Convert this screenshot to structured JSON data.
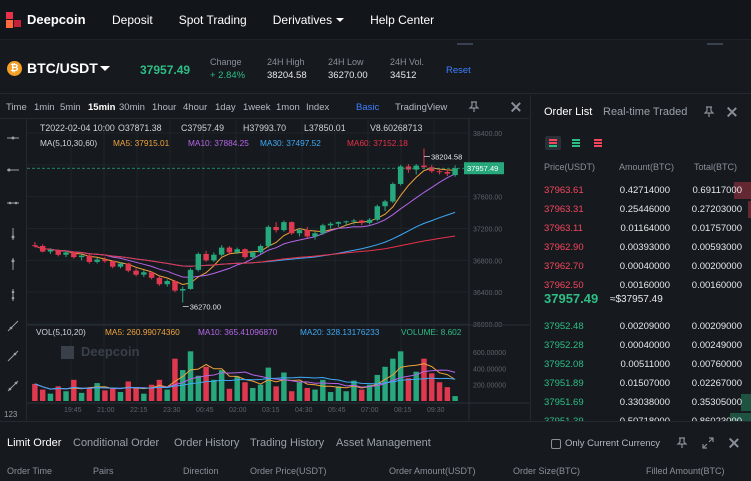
{
  "nav": {
    "brand": "Deepcoin",
    "items": [
      "Deposit",
      "Spot Trading",
      "Derivatives",
      "Help Center"
    ]
  },
  "ticker": {
    "coin_symbol": "₿",
    "pair": "BTC/USDT",
    "last_price": "37957.49",
    "stats": [
      {
        "label": "Change",
        "value": "+ 2.84%"
      },
      {
        "label": "24H High",
        "value": "38204.58"
      },
      {
        "label": "24H Low",
        "value": "36270.00"
      },
      {
        "label": "24H Vol.",
        "value": "34512"
      }
    ],
    "reset": "Reset"
  },
  "chart_toolbar": {
    "timeframes": [
      "Time",
      "1min",
      "5min",
      "15min",
      "30min",
      "1hour",
      "4hour",
      "1day",
      "1week",
      "1mon",
      "Index"
    ],
    "active": "15min",
    "views": [
      "Basic",
      "TradingView"
    ]
  },
  "chart_data": {
    "type": "candlestick",
    "info_line": [
      "T2022-02-04 10:00",
      "O37871.38",
      "C37957.49",
      "H37993.70",
      "L37850.01",
      "V8.60268713"
    ],
    "ma_label": "MA(5,10,30,60)",
    "ma_values": [
      {
        "name": "MA5",
        "text": "MA5: 37915.01",
        "color": "#f0a23b"
      },
      {
        "name": "MA10",
        "text": "MA10: 37884.25",
        "color": "#b565e8"
      },
      {
        "name": "MA30",
        "text": "MA30: 37497.52",
        "color": "#3fa9f5"
      },
      {
        "name": "MA60",
        "text": "MA60: 37152.18",
        "color": "#e8314a"
      }
    ],
    "price_axis": [
      "38400.00",
      "38000.00",
      "37600.00",
      "37200.00",
      "36800.00",
      "36400.00",
      "36000.00"
    ],
    "ylim": [
      36000,
      38400
    ],
    "high_marker": "38204.58",
    "low_marker": "36270.00",
    "last_label": "37957.49",
    "candles": [
      [
        36990,
        37030,
        36960,
        36980
      ],
      [
        36980,
        37000,
        36900,
        36910
      ],
      [
        36910,
        36950,
        36880,
        36930
      ],
      [
        36930,
        36940,
        36850,
        36870
      ],
      [
        36870,
        36920,
        36840,
        36900
      ],
      [
        36900,
        36910,
        36820,
        36840
      ],
      [
        36840,
        36870,
        36800,
        36860
      ],
      [
        36860,
        36880,
        36760,
        36780
      ],
      [
        36780,
        36830,
        36760,
        36810
      ],
      [
        36810,
        36840,
        36770,
        36790
      ],
      [
        36790,
        36800,
        36700,
        36720
      ],
      [
        36720,
        36780,
        36700,
        36760
      ],
      [
        36760,
        36770,
        36650,
        36670
      ],
      [
        36670,
        36700,
        36600,
        36620
      ],
      [
        36620,
        36680,
        36590,
        36650
      ],
      [
        36650,
        36660,
        36560,
        36580
      ],
      [
        36580,
        36600,
        36480,
        36500
      ],
      [
        36500,
        36560,
        36470,
        36540
      ],
      [
        36540,
        36550,
        36400,
        36420
      ],
      [
        36420,
        36470,
        36270,
        36440
      ],
      [
        36440,
        36700,
        36430,
        36680
      ],
      [
        36680,
        36900,
        36660,
        36880
      ],
      [
        36880,
        36920,
        36780,
        36800
      ],
      [
        36800,
        36900,
        36780,
        36870
      ],
      [
        36870,
        36990,
        36850,
        36960
      ],
      [
        36960,
        36980,
        36870,
        36900
      ],
      [
        36900,
        36960,
        36880,
        36940
      ],
      [
        36940,
        36950,
        36820,
        36840
      ],
      [
        36840,
        36920,
        36820,
        36900
      ],
      [
        36900,
        37000,
        36880,
        36980
      ],
      [
        36980,
        37240,
        36960,
        37220
      ],
      [
        37220,
        37280,
        37150,
        37180
      ],
      [
        37180,
        37300,
        37160,
        37280
      ],
      [
        37280,
        37290,
        37120,
        37140
      ],
      [
        37140,
        37200,
        37100,
        37180
      ],
      [
        37180,
        37220,
        37080,
        37100
      ],
      [
        37100,
        37160,
        37060,
        37140
      ],
      [
        37140,
        37260,
        37120,
        37240
      ],
      [
        37240,
        37280,
        37200,
        37260
      ],
      [
        37260,
        37290,
        37220,
        37280
      ],
      [
        37280,
        37300,
        37240,
        37290
      ],
      [
        37290,
        37320,
        37250,
        37300
      ],
      [
        37300,
        37310,
        37240,
        37270
      ],
      [
        37270,
        37330,
        37250,
        37310
      ],
      [
        37310,
        37500,
        37290,
        37480
      ],
      [
        37480,
        37560,
        37420,
        37540
      ],
      [
        37540,
        37780,
        37520,
        37760
      ],
      [
        37760,
        38000,
        37740,
        37980
      ],
      [
        37980,
        38010,
        37900,
        37940
      ],
      [
        37940,
        38010,
        37880,
        37990
      ],
      [
        37990,
        38204.58,
        37950,
        37970
      ],
      [
        37970,
        38000,
        37900,
        37920
      ],
      [
        37920,
        37960,
        37880,
        37910
      ],
      [
        37910,
        37940,
        37860,
        37890
      ],
      [
        37871.38,
        37993.7,
        37850.01,
        37957.49
      ]
    ],
    "volume_label": "VOL(5,10,20)",
    "volume_ma": [
      {
        "name": "MA5",
        "text": "MA5: 260.99074360",
        "color": "#f0a23b"
      },
      {
        "name": "MA10",
        "text": "MA10: 365.41096870",
        "color": "#b565e8"
      },
      {
        "name": "MA20",
        "text": "MA20: 328.13176233",
        "color": "#3fa9f5"
      }
    ],
    "volume_value": "VOLUME: 8.602",
    "volume_axis": [
      "600.00000",
      "400.00000",
      "200.00000"
    ],
    "volume_ylim": [
      0,
      700
    ],
    "volumes": [
      210,
      140,
      90,
      180,
      120,
      260,
      100,
      160,
      220,
      130,
      150,
      110,
      240,
      170,
      90,
      200,
      260,
      140,
      520,
      380,
      610,
      310,
      420,
      260,
      380,
      150,
      300,
      230,
      160,
      200,
      410,
      180,
      350,
      120,
      230,
      160,
      140,
      260,
      110,
      180,
      120,
      250,
      140,
      200,
      320,
      420,
      520,
      610,
      280,
      360,
      520,
      340,
      230,
      170,
      60
    ],
    "time_labels": [
      "19:45",
      "21:00",
      "22:15",
      "23:30",
      "00:45",
      "02:00",
      "03:15",
      "04:30",
      "05:45",
      "07:00",
      "08:15",
      "09:30"
    ],
    "watermark": "Deepcoin"
  },
  "orderbook": {
    "tabs": [
      "Order List",
      "Real-time Traded"
    ],
    "headers": [
      "Price(USDT)",
      "Amount(BTC)",
      "Total(BTC)"
    ],
    "asks": [
      {
        "price": "37963.61",
        "amount": "0.42714000",
        "total": "0.69117000",
        "depth": 0.08
      },
      {
        "price": "37963.31",
        "amount": "0.25446000",
        "total": "0.27203000",
        "depth": 0.02
      },
      {
        "price": "37963.11",
        "amount": "0.01164000",
        "total": "0.01757000",
        "depth": 0.0
      },
      {
        "price": "37962.90",
        "amount": "0.00393000",
        "total": "0.00593000",
        "depth": 0.0
      },
      {
        "price": "37962.70",
        "amount": "0.00040000",
        "total": "0.00200000",
        "depth": 0.0
      },
      {
        "price": "37962.50",
        "amount": "0.00160000",
        "total": "0.00160000",
        "depth": 0.0
      }
    ],
    "last_price": "37957.49",
    "last_usd": "≈$37957.49",
    "bids": [
      {
        "price": "37952.48",
        "amount": "0.00209000",
        "total": "0.00209000",
        "depth": 0.0
      },
      {
        "price": "37952.28",
        "amount": "0.00040000",
        "total": "0.00249000",
        "depth": 0.0
      },
      {
        "price": "37952.08",
        "amount": "0.00511000",
        "total": "0.00760000",
        "depth": 0.0
      },
      {
        "price": "37951.89",
        "amount": "0.01507000",
        "total": "0.02267000",
        "depth": 0.0
      },
      {
        "price": "37951.69",
        "amount": "0.33038000",
        "total": "0.35305000",
        "depth": 0.05
      },
      {
        "price": "37951.39",
        "amount": "0.50718000",
        "total": "0.86023000",
        "depth": 0.1
      }
    ],
    "colors": {
      "ask": "#f6465d",
      "bid": "#2ebd85"
    }
  },
  "orders": {
    "tabs": [
      "Limit Order",
      "Conditional Order",
      "Order History",
      "Trading History",
      "Asset Management"
    ],
    "only_current": "Only Current Currency",
    "columns": [
      "Order Time",
      "Pairs",
      "Direction",
      "Order Price(USDT)",
      "Order Amount(USDT)",
      "Order Size(BTC)",
      "Filled Amount(BTC)"
    ]
  }
}
